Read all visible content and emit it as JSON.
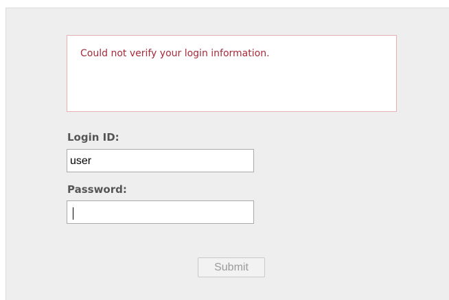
{
  "login": {
    "error_message": "Could not verify your login information.",
    "login_id_label": "Login ID:",
    "login_id_value": "user",
    "password_label": "Password:",
    "password_value": "",
    "submit_label": "Submit"
  },
  "colors": {
    "panel_background": "#eeeeee",
    "error_text": "#a52a3a",
    "error_border": "#e3b0b3",
    "label_text": "#555555"
  }
}
